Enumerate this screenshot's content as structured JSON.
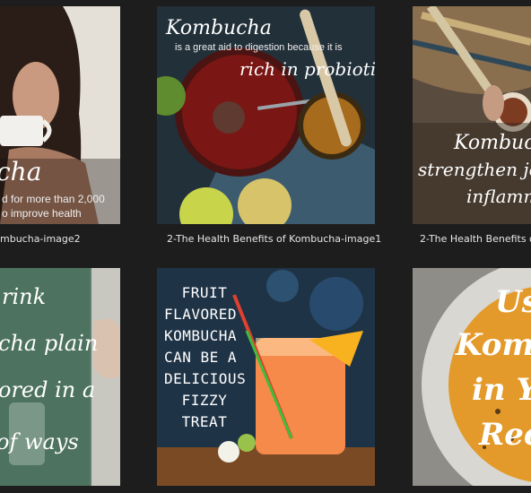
{
  "thumbnails": [
    {
      "caption": "mbucha-image2",
      "overlay": [
        "cha",
        "d for more than 2,000",
        "o improve health"
      ]
    },
    {
      "caption": "2-The Health Benefits of Kombucha-image1",
      "overlay": [
        "Kombucha",
        "is a great aid to digestion because it is",
        "rich in probiotics"
      ]
    },
    {
      "caption": "2-The Health Benefits o",
      "overlay": [
        "Kombucha",
        "strengthen join",
        "inflamm"
      ]
    },
    {
      "caption": "",
      "overlay": [
        "rink",
        "cha plain",
        "ored in a",
        "of ways"
      ]
    },
    {
      "caption": "",
      "overlay": [
        "FRUIT",
        "FLAVORED",
        "KOMBUCHA",
        "CAN BE A",
        "DELICIOUS",
        "FIZZY",
        "TREAT"
      ]
    },
    {
      "caption": "",
      "overlay": [
        "Us",
        "Kombu",
        "in Y",
        "Reci"
      ]
    }
  ]
}
